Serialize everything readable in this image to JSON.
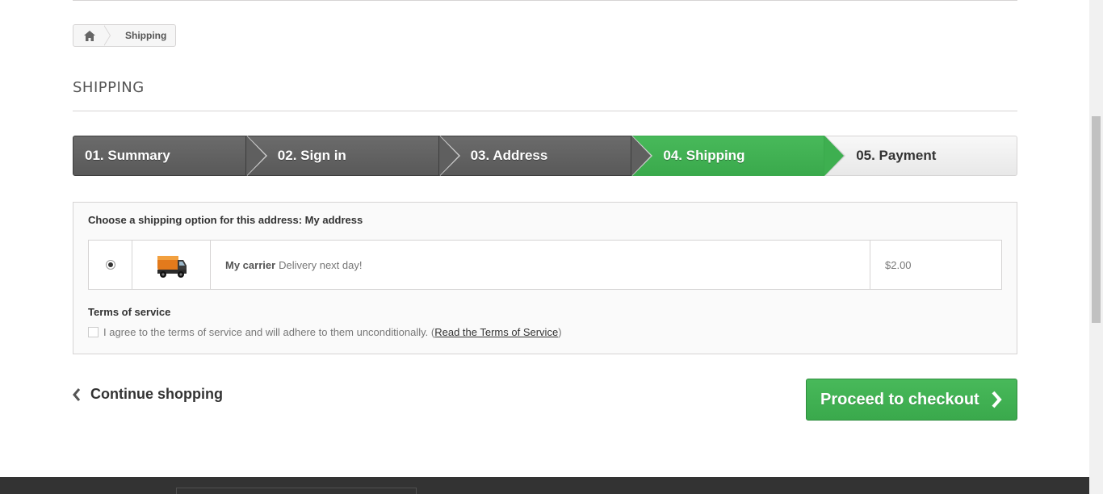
{
  "breadcrumb": {
    "home_icon": "home-icon",
    "current": "Shipping"
  },
  "page": {
    "heading": "SHIPPING"
  },
  "steps": [
    {
      "label": "01. Summary",
      "state": "done"
    },
    {
      "label": "02. Sign in",
      "state": "done"
    },
    {
      "label": "03. Address",
      "state": "done"
    },
    {
      "label": "04. Shipping",
      "state": "current"
    },
    {
      "label": "05. Payment",
      "state": "todo"
    }
  ],
  "shipping": {
    "choose_label": "Choose a shipping option for this address: My address",
    "carrier": {
      "selected": true,
      "icon": "truck-icon",
      "name": "My carrier",
      "delay": "Delivery next day!",
      "price": "$2.00"
    }
  },
  "terms": {
    "title": "Terms of service",
    "agree_text": "I agree to the terms of service and will adhere to them unconditionally.",
    "link_open": "(",
    "link_text": "Read the Terms of Service",
    "link_close": ")"
  },
  "actions": {
    "continue_label": "Continue shopping",
    "checkout_label": "Proceed to checkout"
  },
  "colors": {
    "accent_green": "#3aa94c",
    "step_dark": "#5f5f5f"
  }
}
